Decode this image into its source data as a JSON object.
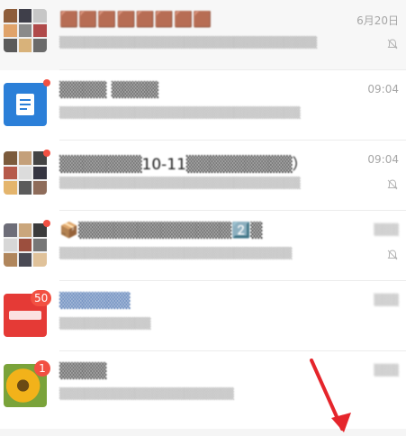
{
  "chats": [
    {
      "title": "🟫🟫🟫🟫🟫🟫🟫🟫",
      "snippet": "▒▒▒▒▒▒▒▒▒▒▒▒▒▒▒▒▒▒▒▒▒▒▒▒▒▒▒▒▒▒▒",
      "time": "6月20日",
      "muted": true
    },
    {
      "title": "▒▒▒▒ ▒▒▒▒",
      "snippet": "▒▒▒▒▒▒▒▒▒▒▒▒▒▒▒▒▒▒▒▒▒▒▒▒▒▒▒▒▒",
      "time": "09:04",
      "muted": false,
      "unread_dot": true
    },
    {
      "title": "▒▒▒▒▒▒▒10-11▒▒▒▒▒▒▒▒▒）",
      "snippet": "▒▒▒▒▒▒▒▒▒▒▒▒▒▒▒▒▒▒▒▒▒▒▒▒▒▒▒▒▒",
      "time": "09:04",
      "muted": true,
      "unread_dot": true
    },
    {
      "title": "📦▒▒▒▒▒▒▒▒▒▒▒▒▒2️⃣▒",
      "snippet": "▒▒▒▒▒▒▒▒▒▒▒▒▒▒▒▒▒▒▒▒▒▒▒▒▒▒▒▒",
      "time": "▒▒▒",
      "muted": true,
      "unread_dot": true
    },
    {
      "title": "▒▒▒▒▒▒",
      "snippet": "▒▒▒▒▒▒▒▒▒▒▒",
      "time": "▒▒▒",
      "muted": false,
      "badge": "50"
    },
    {
      "title": "▒▒▒▒",
      "snippet": "▒▒▒▒▒▒▒▒▒▒▒▒▒▒▒▒▒▒▒▒▒",
      "time": "▒▒▒",
      "muted": false,
      "badge": "1"
    }
  ],
  "colors": {
    "accent_red": "#f25042",
    "link_blue": "#1d4f9c",
    "doc_blue": "#2b7fd8",
    "arrow_red": "#e5252b"
  },
  "icons": {
    "mute": "bell-off-icon",
    "doc": "document-icon",
    "annotation": "arrow-icon"
  }
}
